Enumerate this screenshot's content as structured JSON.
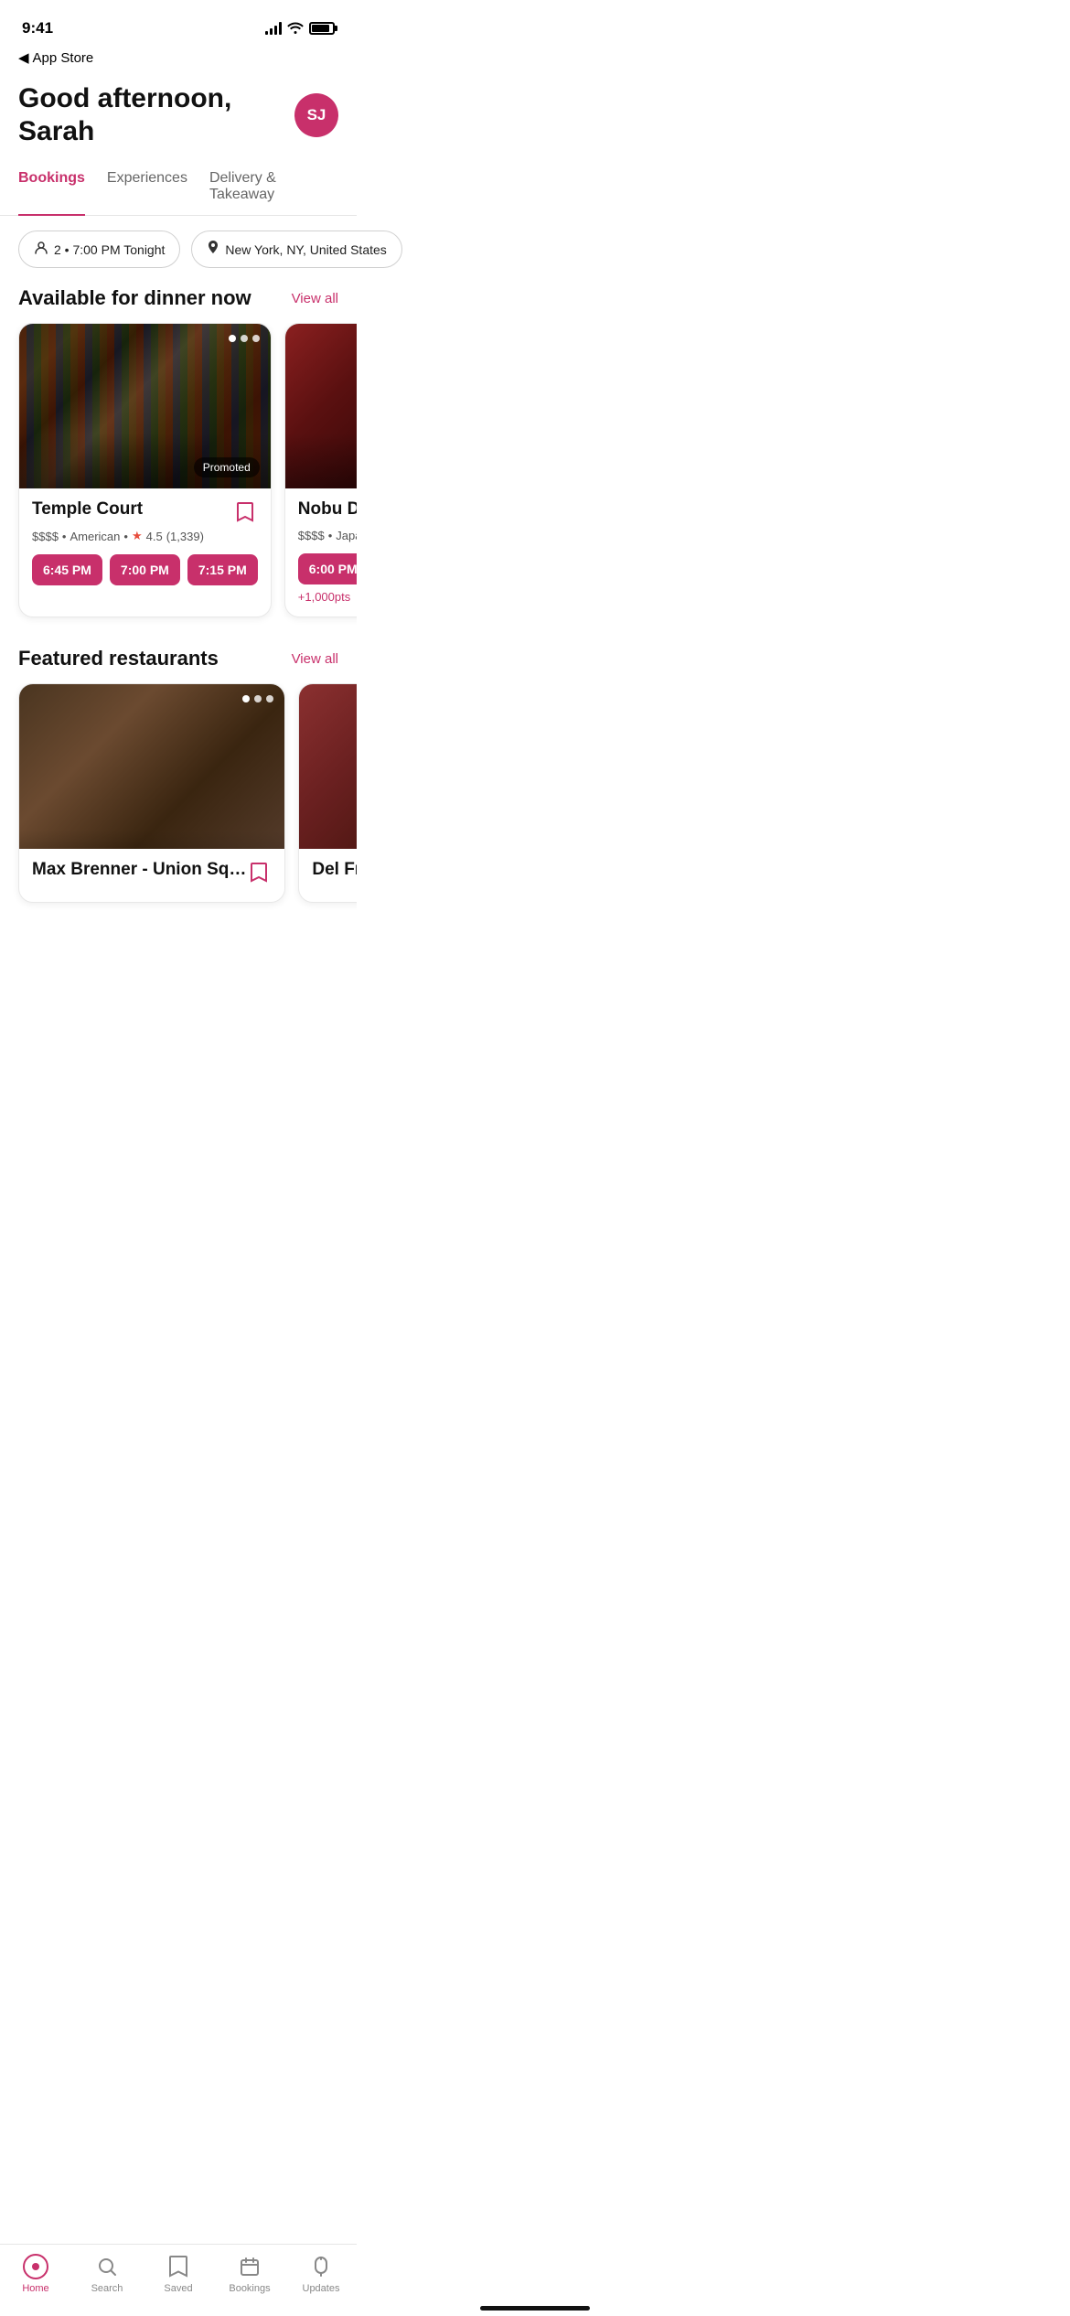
{
  "statusBar": {
    "time": "9:41",
    "backLabel": "App Store"
  },
  "header": {
    "greeting": "Good afternoon, Sarah",
    "avatarInitials": "SJ",
    "avatarColor": "#c8306b"
  },
  "tabs": [
    {
      "label": "Bookings",
      "active": true
    },
    {
      "label": "Experiences",
      "active": false
    },
    {
      "label": "Delivery & Takeaway",
      "active": false
    }
  ],
  "filters": [
    {
      "icon": "👤",
      "label": "2 • 7:00 PM Tonight"
    },
    {
      "icon": "📍",
      "label": "New York, NY, United States"
    }
  ],
  "sections": [
    {
      "id": "available-dinner",
      "title": "Available for dinner now",
      "viewAll": "View all",
      "restaurants": [
        {
          "id": "temple-court",
          "name": "Temple Court",
          "price": "$$$$",
          "cuisine": "American",
          "rating": "4.5",
          "reviewCount": "1,339",
          "promoted": true,
          "promotedLabel": "Promoted",
          "timeSlots": [
            "6:45 PM",
            "7:00 PM",
            "7:15 PM"
          ],
          "pts": null,
          "imgClass": "img-temple-court"
        },
        {
          "id": "nobu-downtown",
          "name": "Nobu Downt…",
          "price": "$$$$",
          "cuisine": "Japanese",
          "rating": null,
          "reviewCount": null,
          "promoted": false,
          "promotedLabel": null,
          "timeSlots": [
            "6:00 PM"
          ],
          "pts": "+1,000pts",
          "imgClass": "img-nobu"
        }
      ]
    },
    {
      "id": "featured-restaurants",
      "title": "Featured restaurants",
      "viewAll": "View all",
      "restaurants": [
        {
          "id": "max-brenner",
          "name": "Max Brenner - Union Sq…",
          "price": null,
          "cuisine": null,
          "rating": null,
          "reviewCount": null,
          "promoted": false,
          "promotedLabel": null,
          "timeSlots": [],
          "pts": null,
          "imgClass": "img-max-brenner"
        },
        {
          "id": "del-frisco",
          "name": "Del Frisco's G…",
          "price": null,
          "cuisine": null,
          "rating": null,
          "reviewCount": null,
          "promoted": false,
          "promotedLabel": null,
          "timeSlots": [],
          "pts": null,
          "imgClass": "img-del-frisco"
        }
      ]
    }
  ],
  "bottomNav": [
    {
      "id": "home",
      "label": "Home",
      "active": true
    },
    {
      "id": "search",
      "label": "Search",
      "active": false
    },
    {
      "id": "saved",
      "label": "Saved",
      "active": false
    },
    {
      "id": "bookings",
      "label": "Bookings",
      "active": false
    },
    {
      "id": "updates",
      "label": "Updates",
      "active": false
    }
  ]
}
